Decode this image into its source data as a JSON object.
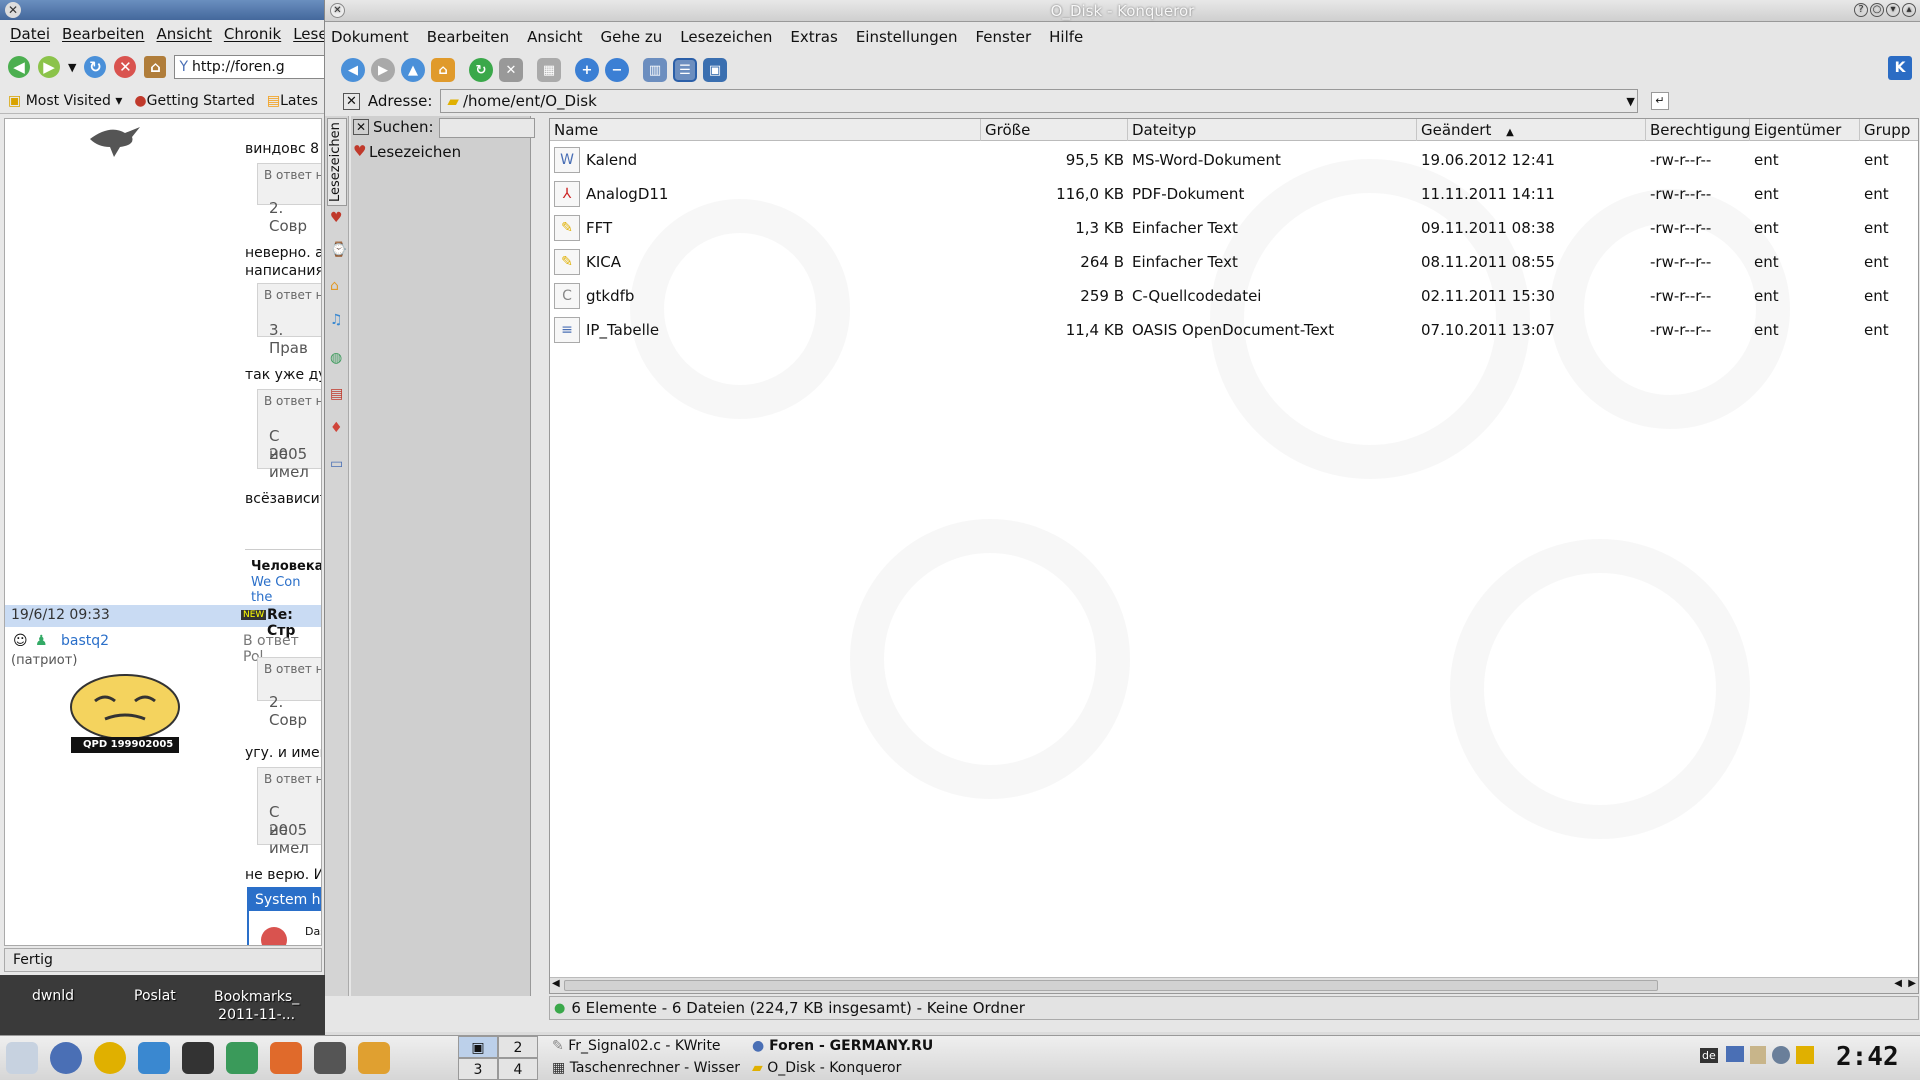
{
  "firefox": {
    "menu": [
      "Datei",
      "Bearbeiten",
      "Ansicht",
      "Chronik",
      "Lesez"
    ],
    "url": "http://foren.g",
    "bookmarks": [
      "Most Visited",
      "Getting Started",
      "Lates"
    ],
    "posts": [
      {
        "text": "виндовс 8"
      },
      {
        "quote_small": "В ответ н",
        "quote_big": "2. Совр"
      },
      {
        "text1": "неверно. а",
        "text2": "написания"
      },
      {
        "quote_small": "В ответ н",
        "quote_big": "3. Прав"
      },
      {
        "text": "так уже ду"
      },
      {
        "quote_small": "В ответ н",
        "quote_big": "С 2005",
        "quote_big2": "не имел"
      },
      {
        "text": "всёзависит"
      }
    ],
    "signature": {
      "title": "Человека",
      "link": "We Con the"
    },
    "post_header": {
      "date": "19/6/12 09:33",
      "badge": "NEW",
      "subject": "Re: Стр"
    },
    "user": {
      "name": "bastq2",
      "role": "(патриот)",
      "reply_to": "В ответ Pol",
      "avatar_caption": "QPD 199902005"
    },
    "posts2": [
      {
        "quote_small": "В ответ н",
        "quote_big": "2. Совр"
      },
      {
        "text": "угу. и имен"
      },
      {
        "quote_small": "В ответ н",
        "quote_big": "С 2005",
        "quote_big2": "не имел"
      },
      {
        "text": "не верю. И"
      }
    ],
    "popup": {
      "title": "System he",
      "body": "Das"
    },
    "status": "Fertig"
  },
  "desktop_icons": [
    {
      "label": "dwnld"
    },
    {
      "label": "Poslat"
    },
    {
      "label": "Bookmarks_",
      "label2": "2011-11-..."
    }
  ],
  "konqueror": {
    "title": "O_Disk - Konqueror",
    "menu": [
      "Dokument",
      "Bearbeiten",
      "Ansicht",
      "Gehe zu",
      "Lesezeichen",
      "Extras",
      "Einstellungen",
      "Fenster",
      "Hilfe"
    ],
    "address_label": "Adresse:",
    "address": "/home/ent/O_Disk",
    "sidebar": {
      "tab_label": "Lesezeichen",
      "search_label": "Suchen:",
      "search_value": "",
      "tree_item": "Lesezeichen"
    },
    "columns": [
      "Name",
      "Größe",
      "Dateityp",
      "Geändert",
      "Berechtigunge",
      "Eigentümer",
      "Grupp"
    ],
    "sort_column": "Geändert",
    "files": [
      {
        "name": "Kalend",
        "size": "95,5 KB",
        "type": "MS-Word-Dokument",
        "modified": "19.06.2012 12:41",
        "perm": "-rw-r--r--",
        "owner": "ent",
        "group": "ent",
        "icon": "word-doc-icon"
      },
      {
        "name": "AnalogD11",
        "size": "116,0 KB",
        "type": "PDF-Dokument",
        "modified": "11.11.2011 14:11",
        "perm": "-rw-r--r--",
        "owner": "ent",
        "group": "ent",
        "icon": "pdf-icon"
      },
      {
        "name": "FFT",
        "size": "1,3 KB",
        "type": "Einfacher Text",
        "modified": "09.11.2011 08:38",
        "perm": "-rw-r--r--",
        "owner": "ent",
        "group": "ent",
        "icon": "text-file-icon"
      },
      {
        "name": "KICA",
        "size": "264 B",
        "type": "Einfacher Text",
        "modified": "08.11.2011 08:55",
        "perm": "-rw-r--r--",
        "owner": "ent",
        "group": "ent",
        "icon": "text-file-icon"
      },
      {
        "name": "gtkdfb",
        "size": "259 B",
        "type": "C-Quellcodedatei",
        "modified": "02.11.2011 15:30",
        "perm": "-rw-r--r--",
        "owner": "ent",
        "group": "ent",
        "icon": "c-source-icon"
      },
      {
        "name": "IP_Tabelle",
        "size": "11,4 KB",
        "type": "OASIS OpenDocument-Text",
        "modified": "07.10.2011 13:07",
        "perm": "-rw-r--r--",
        "owner": "ent",
        "group": "ent",
        "icon": "odt-icon"
      }
    ],
    "status": "6 Elemente - 6 Dateien (224,7 KB insgesamt) - Keine Ordner"
  },
  "taskbar": {
    "pager": [
      "2",
      "3",
      "4"
    ],
    "tasks": [
      {
        "label": "Fr_Signal02.c - KWrite"
      },
      {
        "label": "Foren - GERMANY.RU"
      },
      {
        "label": "Taschenrechner - Wisser"
      },
      {
        "label": "O_Disk - Konqueror"
      }
    ],
    "clock": "2:42"
  },
  "colors": {
    "accent": "#0a5fd0",
    "titlebar": "#cfcfcf",
    "pdf": "#cc2222",
    "folder": "#e0b000"
  }
}
